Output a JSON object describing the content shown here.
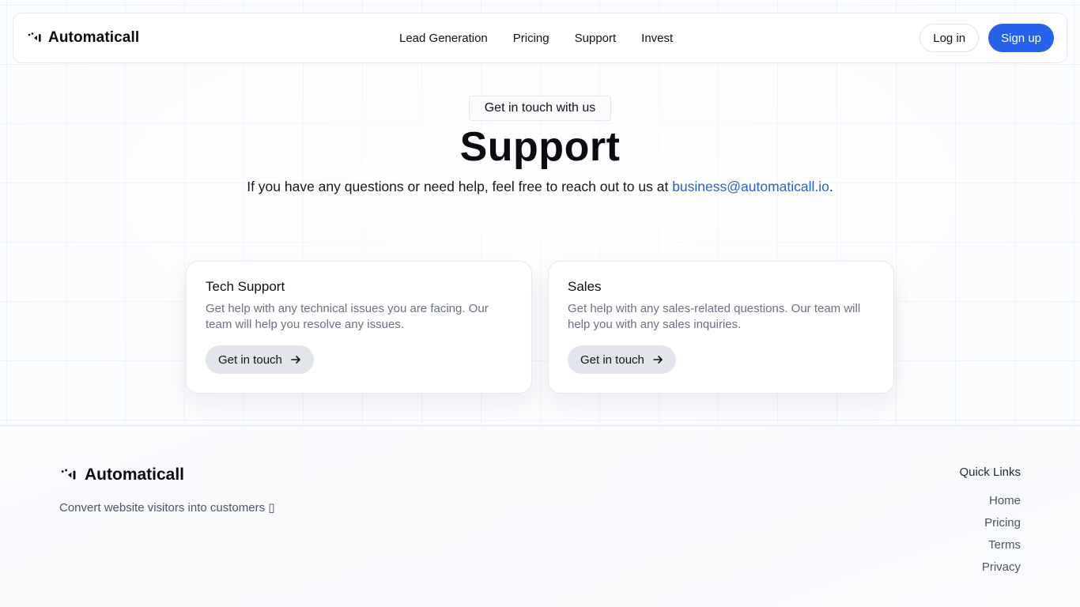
{
  "brand": {
    "name": "Automaticall",
    "icon": "sound-wave-icon"
  },
  "nav": {
    "links": [
      "Lead Generation",
      "Pricing",
      "Support",
      "Invest"
    ],
    "login_label": "Log in",
    "signup_label": "Sign up"
  },
  "hero": {
    "eyebrow": "Get in touch with us",
    "title": "Support",
    "subtitle_prefix": "If you have any questions or need help, feel free to reach out to us at ",
    "email": "business@automaticall.io",
    "subtitle_suffix": "."
  },
  "cards": [
    {
      "title": "Tech Support",
      "description": "Get help with any technical issues you are facing. Our team will help you resolve any issues.",
      "button_label": "Get in touch"
    },
    {
      "title": "Sales",
      "description": "Get help with any sales-related questions. Our team will help you with any sales inquiries.",
      "button_label": "Get in touch"
    }
  ],
  "footer": {
    "brand_name": "Automaticall",
    "tagline": "Convert website visitors into customers ▯",
    "quick_links_title": "Quick Links",
    "quick_links": [
      "Home",
      "Pricing",
      "Terms",
      "Privacy"
    ]
  },
  "colors": {
    "accent": "#2563eb",
    "link": "#2b62c8",
    "card_button_bg": "#e2e6ec"
  }
}
